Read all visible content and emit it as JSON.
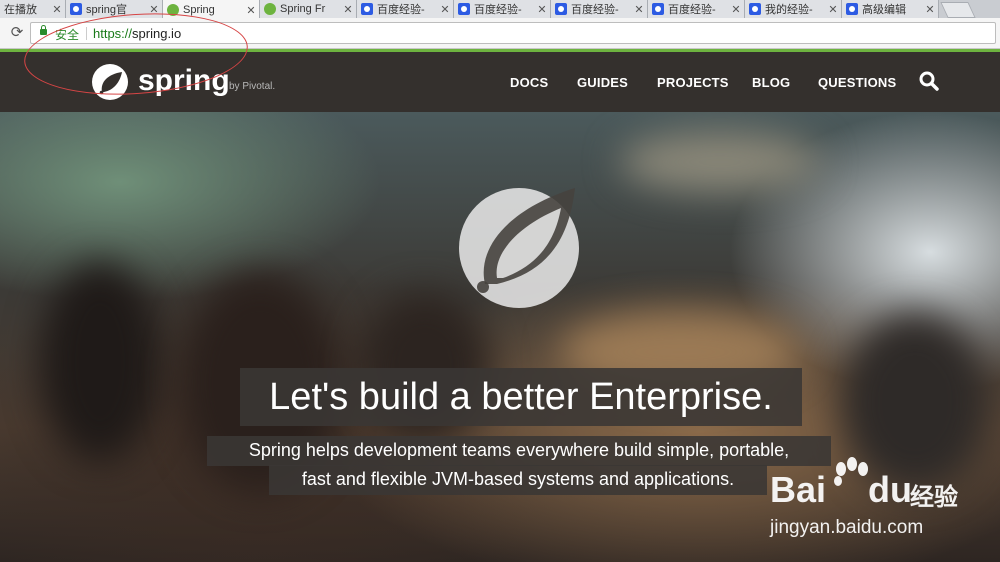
{
  "browser": {
    "tabs": [
      {
        "title": "在播放",
        "favicon": "none",
        "active": false
      },
      {
        "title": "spring官",
        "favicon": "baidu-paw-icon",
        "active": false
      },
      {
        "title": "Spring",
        "favicon": "spring-leaf-icon",
        "active": true
      },
      {
        "title": "Spring Fr",
        "favicon": "spring-leaf-icon",
        "active": false
      },
      {
        "title": "百度经验-",
        "favicon": "baidu-paw-icon",
        "active": false
      },
      {
        "title": "百度经验-",
        "favicon": "baidu-paw-icon",
        "active": false
      },
      {
        "title": "百度经验-",
        "favicon": "baidu-paw-icon",
        "active": false
      },
      {
        "title": "百度经验-",
        "favicon": "baidu-paw-icon",
        "active": false
      },
      {
        "title": "我的经验-",
        "favicon": "baidu-paw-icon",
        "active": false
      },
      {
        "title": "高级编辑",
        "favicon": "baidu-paw-icon",
        "active": false
      }
    ],
    "security_label": "安全",
    "url_scheme": "https://",
    "url_host": "spring.io"
  },
  "site": {
    "brand": "spring",
    "by_label": "by Pivotal.",
    "nav": [
      {
        "label": "DOCS"
      },
      {
        "label": "GUIDES"
      },
      {
        "label": "PROJECTS"
      },
      {
        "label": "BLOG"
      },
      {
        "label": "QUESTIONS"
      }
    ],
    "colors": {
      "nav_bg": "#34302d",
      "brand_green": "#6db33f"
    }
  },
  "hero": {
    "headline": "Let's build a better Enterprise.",
    "subline_1": "Spring helps development teams everywhere build simple, portable,",
    "subline_2": "fast and flexible JVM-based systems and applications."
  },
  "watermark": {
    "bai": "Bai",
    "du": "du",
    "jingyan": "经验",
    "site": "jingyan.baidu.com"
  }
}
